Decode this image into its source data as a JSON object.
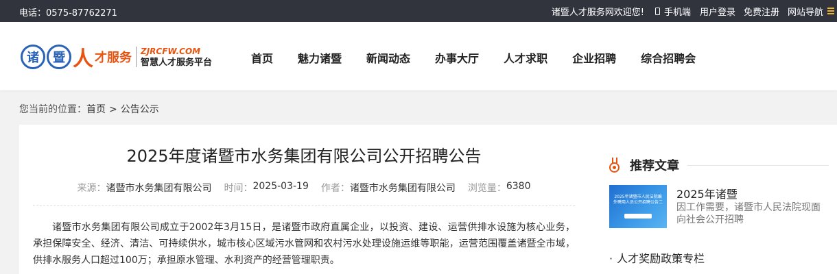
{
  "topbar": {
    "phone": "电话：0575-87762271",
    "welcome": "诸暨人才服务网欢迎您!",
    "mobile": "手机端",
    "login": "用户登录",
    "register": "免费注册",
    "site_nav": "网站导航"
  },
  "logo": {
    "seal_1": "诸",
    "seal_2": "暨",
    "ren": "人",
    "brand_cn": "才服务",
    "brand_en": "ZJRCFW.COM",
    "slogan": "智慧人才服务平台"
  },
  "nav": [
    "首页",
    "魅力诸暨",
    "新闻动态",
    "办事大厅",
    "人才求职",
    "企业招聘",
    "综合招聘会"
  ],
  "breadcrumb": {
    "prefix": "您当前的位置：",
    "home": "首页",
    "sep": ">",
    "current": "公告公示"
  },
  "article": {
    "title": "2025年度诸暨市水务集团有限公司公开招聘公告",
    "source_label": "来源：",
    "source": "诸暨市水务集团有限公司",
    "time_label": "时间：",
    "time": "2025-03-19",
    "author_label": "作者：",
    "author": "诸暨市水务集团有限公司",
    "views_label": "浏览量：",
    "views": "6380",
    "para1": "诸暨市水务集团有限公司成立于2002年3月15日，是诸暨市政府直属企业，以投资、建设、运营供排水设施为核心业务，承担保障安全、经济、清洁、可持续供水，城市核心区域污水管网和农村污水处理设施运维等职能，运营范围覆盖诸暨全市域，供排水服务人口超过100万；承担原水管理、水利资产的经营管理职责。"
  },
  "sidebar": {
    "heading": "推荐文章",
    "rec_title": "2025年诸暨",
    "rec_desc": "因工作需要，诸暨市人民法院现面向社会公开招聘",
    "thumb_text": "2025年诸暨市人民法院编外聘用人员公开招聘公告二",
    "link": "人才奖励政策专栏"
  },
  "colors": {
    "topbar_bg": "#31343d",
    "accent_orange": "#e6540f",
    "logo_blue": "#2a62b8"
  }
}
